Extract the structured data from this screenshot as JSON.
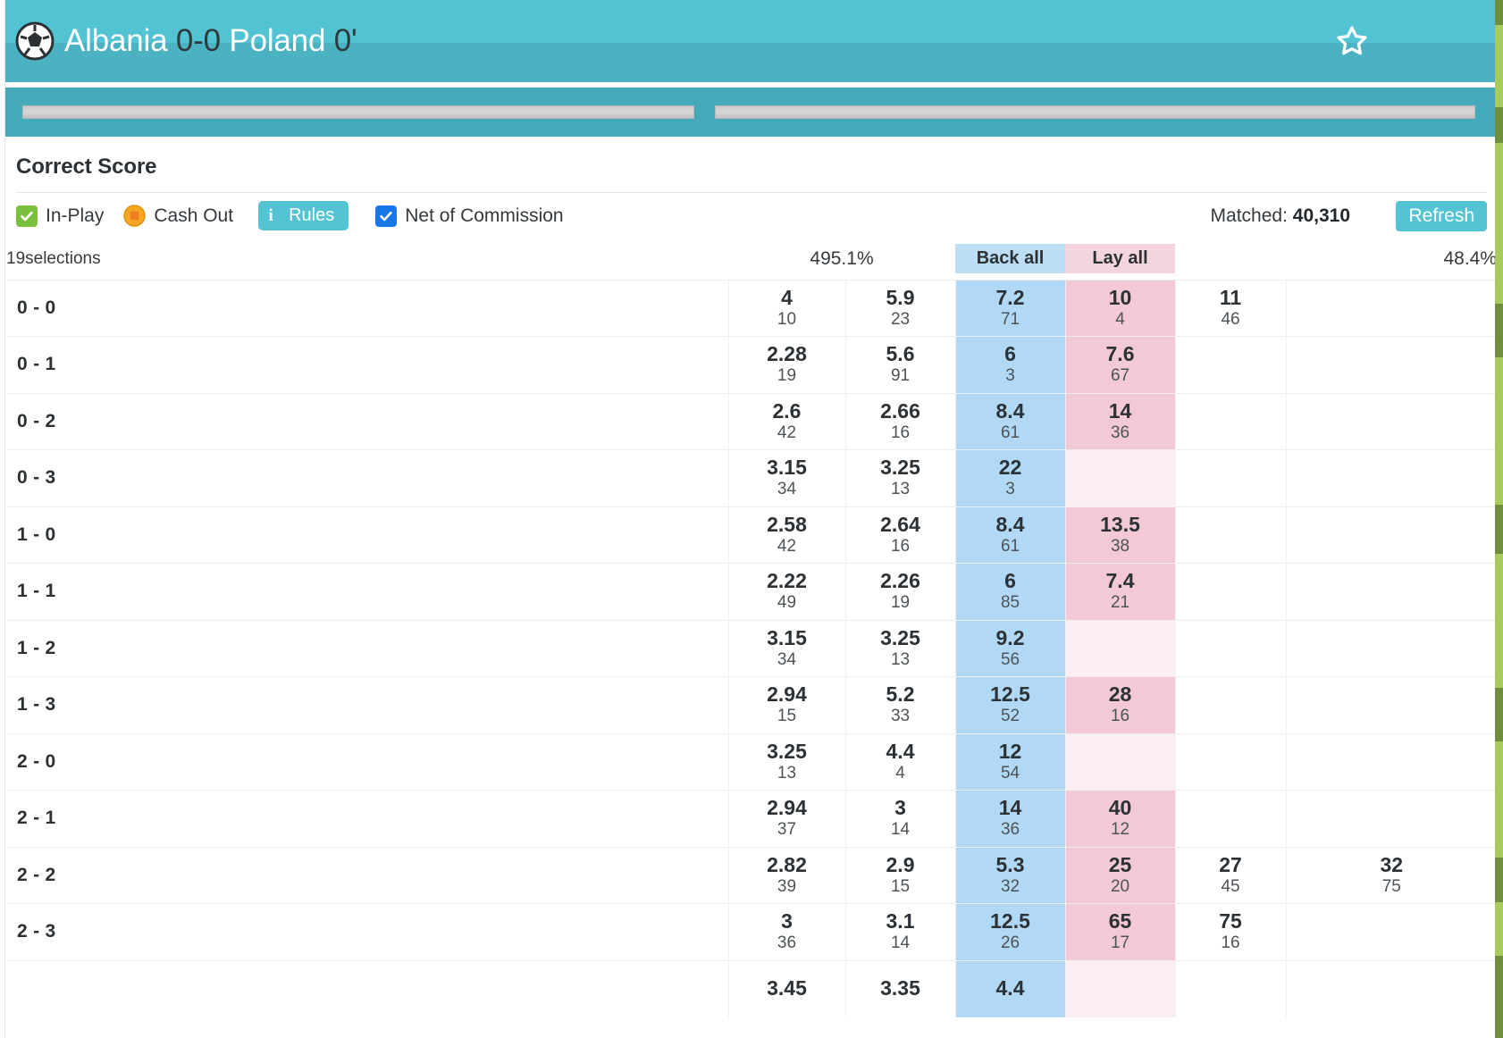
{
  "header": {
    "team_home": "Albania",
    "score": "0-0",
    "team_away": "Poland",
    "clock": "0'",
    "ball_icon": "football-icon",
    "favourite_icon": "star-outline-icon"
  },
  "market": {
    "title": "Correct Score",
    "selections_count": "19selections",
    "back_percent": "495.1%",
    "lay_percent": "48.4%",
    "back_all_label": "Back all",
    "lay_all_label": "Lay all"
  },
  "controls": {
    "in_play_label": "In-Play",
    "in_play_checked": true,
    "cash_out_label": "Cash Out",
    "cash_out_icon": "coin-icon",
    "rules_label": "Rules",
    "rules_info_icon": "i",
    "net_of_commission_label": "Net of Commission",
    "net_of_commission_checked": true,
    "matched_label": "Matched:",
    "matched_value": "40,310",
    "refresh_label": "Refresh"
  },
  "colors": {
    "header_teal": "#51c3d3",
    "header_teal_dark": "#4bb2c2",
    "tabstrip_teal": "#44a9b9",
    "back_best": "#b1d8f4",
    "back_all": "#bcddf4",
    "lay_best": "#f2c9d4",
    "lay_all": "#f4d4dd",
    "lay_empty": "#fbeef1",
    "checkbox_green": "#7bbf3f",
    "checkbox_blue": "#1877e8",
    "button_teal": "#54c4d4",
    "scroll_green": "#a8cc5c"
  },
  "table": {
    "rows": [
      {
        "runner": "0 - 0",
        "cells": [
          {
            "style": "plain",
            "odds": "4",
            "size": "10"
          },
          {
            "style": "plain",
            "odds": "5.9",
            "size": "23"
          },
          {
            "style": "back-best",
            "odds": "7.2",
            "size": "71"
          },
          {
            "style": "lay-best",
            "odds": "10",
            "size": "4"
          },
          {
            "style": "plain",
            "odds": "11",
            "size": "46"
          },
          {
            "style": "plain",
            "odds": "",
            "size": ""
          }
        ]
      },
      {
        "runner": "0 - 1",
        "cells": [
          {
            "style": "plain",
            "odds": "2.28",
            "size": "19"
          },
          {
            "style": "plain",
            "odds": "5.6",
            "size": "91"
          },
          {
            "style": "back-best",
            "odds": "6",
            "size": "3"
          },
          {
            "style": "lay-best",
            "odds": "7.6",
            "size": "67"
          },
          {
            "style": "plain",
            "odds": "",
            "size": ""
          },
          {
            "style": "plain",
            "odds": "",
            "size": ""
          }
        ]
      },
      {
        "runner": "0 - 2",
        "cells": [
          {
            "style": "plain",
            "odds": "2.6",
            "size": "42"
          },
          {
            "style": "plain",
            "odds": "2.66",
            "size": "16"
          },
          {
            "style": "back-best",
            "odds": "8.4",
            "size": "61"
          },
          {
            "style": "lay-best",
            "odds": "14",
            "size": "36"
          },
          {
            "style": "plain",
            "odds": "",
            "size": ""
          },
          {
            "style": "plain",
            "odds": "",
            "size": ""
          }
        ]
      },
      {
        "runner": "0 - 3",
        "cells": [
          {
            "style": "plain",
            "odds": "3.15",
            "size": "34"
          },
          {
            "style": "plain",
            "odds": "3.25",
            "size": "13"
          },
          {
            "style": "back-best",
            "odds": "22",
            "size": "3"
          },
          {
            "style": "lay-empty",
            "odds": "",
            "size": ""
          },
          {
            "style": "plain",
            "odds": "",
            "size": ""
          },
          {
            "style": "plain",
            "odds": "",
            "size": ""
          }
        ]
      },
      {
        "runner": "1 - 0",
        "cells": [
          {
            "style": "plain",
            "odds": "2.58",
            "size": "42"
          },
          {
            "style": "plain",
            "odds": "2.64",
            "size": "16"
          },
          {
            "style": "back-best",
            "odds": "8.4",
            "size": "61"
          },
          {
            "style": "lay-best",
            "odds": "13.5",
            "size": "38"
          },
          {
            "style": "plain",
            "odds": "",
            "size": ""
          },
          {
            "style": "plain",
            "odds": "",
            "size": ""
          }
        ]
      },
      {
        "runner": "1 - 1",
        "cells": [
          {
            "style": "plain",
            "odds": "2.22",
            "size": "49"
          },
          {
            "style": "plain",
            "odds": "2.26",
            "size": "19"
          },
          {
            "style": "back-best",
            "odds": "6",
            "size": "85"
          },
          {
            "style": "lay-best",
            "odds": "7.4",
            "size": "21"
          },
          {
            "style": "plain",
            "odds": "",
            "size": ""
          },
          {
            "style": "plain",
            "odds": "",
            "size": ""
          }
        ]
      },
      {
        "runner": "1 - 2",
        "cells": [
          {
            "style": "plain",
            "odds": "3.15",
            "size": "34"
          },
          {
            "style": "plain",
            "odds": "3.25",
            "size": "13"
          },
          {
            "style": "back-best",
            "odds": "9.2",
            "size": "56"
          },
          {
            "style": "lay-empty",
            "odds": "",
            "size": ""
          },
          {
            "style": "plain",
            "odds": "",
            "size": ""
          },
          {
            "style": "plain",
            "odds": "",
            "size": ""
          }
        ]
      },
      {
        "runner": "1 - 3",
        "cells": [
          {
            "style": "plain",
            "odds": "2.94",
            "size": "15"
          },
          {
            "style": "plain",
            "odds": "5.2",
            "size": "33"
          },
          {
            "style": "back-best",
            "odds": "12.5",
            "size": "52"
          },
          {
            "style": "lay-best",
            "odds": "28",
            "size": "16"
          },
          {
            "style": "plain",
            "odds": "",
            "size": ""
          },
          {
            "style": "plain",
            "odds": "",
            "size": ""
          }
        ]
      },
      {
        "runner": "2 - 0",
        "cells": [
          {
            "style": "plain",
            "odds": "3.25",
            "size": "13"
          },
          {
            "style": "plain",
            "odds": "4.4",
            "size": "4"
          },
          {
            "style": "back-best",
            "odds": "12",
            "size": "54"
          },
          {
            "style": "lay-empty",
            "odds": "",
            "size": ""
          },
          {
            "style": "plain",
            "odds": "",
            "size": ""
          },
          {
            "style": "plain",
            "odds": "",
            "size": ""
          }
        ]
      },
      {
        "runner": "2 - 1",
        "cells": [
          {
            "style": "plain",
            "odds": "2.94",
            "size": "37"
          },
          {
            "style": "plain",
            "odds": "3",
            "size": "14"
          },
          {
            "style": "back-best",
            "odds": "14",
            "size": "36"
          },
          {
            "style": "lay-best",
            "odds": "40",
            "size": "12"
          },
          {
            "style": "plain",
            "odds": "",
            "size": ""
          },
          {
            "style": "plain",
            "odds": "",
            "size": ""
          }
        ]
      },
      {
        "runner": "2 - 2",
        "cells": [
          {
            "style": "plain",
            "odds": "2.82",
            "size": "39"
          },
          {
            "style": "plain",
            "odds": "2.9",
            "size": "15"
          },
          {
            "style": "back-best",
            "odds": "5.3",
            "size": "32"
          },
          {
            "style": "lay-best",
            "odds": "25",
            "size": "20"
          },
          {
            "style": "plain",
            "odds": "27",
            "size": "45"
          },
          {
            "style": "plain",
            "odds": "32",
            "size": "75"
          }
        ]
      },
      {
        "runner": "2 - 3",
        "cells": [
          {
            "style": "plain",
            "odds": "3",
            "size": "36"
          },
          {
            "style": "plain",
            "odds": "3.1",
            "size": "14"
          },
          {
            "style": "back-best",
            "odds": "12.5",
            "size": "26"
          },
          {
            "style": "lay-best",
            "odds": "65",
            "size": "17"
          },
          {
            "style": "plain",
            "odds": "75",
            "size": "16"
          },
          {
            "style": "plain",
            "odds": "",
            "size": ""
          }
        ]
      },
      {
        "runner": "",
        "cells": [
          {
            "style": "plain",
            "odds": "3.45",
            "size": ""
          },
          {
            "style": "plain",
            "odds": "3.35",
            "size": ""
          },
          {
            "style": "back-best",
            "odds": "4.4",
            "size": ""
          },
          {
            "style": "lay-empty",
            "odds": "",
            "size": ""
          },
          {
            "style": "plain",
            "odds": "",
            "size": ""
          },
          {
            "style": "plain",
            "odds": "",
            "size": ""
          }
        ]
      }
    ]
  }
}
